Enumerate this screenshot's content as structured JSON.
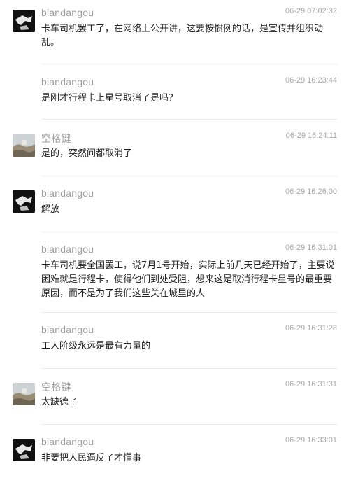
{
  "messages": [
    {
      "username": "biandangou",
      "time": "06-29 07:02:32",
      "avatar": "black-silhouette-avatar",
      "text": "卡车司机罢工了，在网络上公开讲，这要按惯例的话，是宣传并组织动乱。"
    },
    {
      "username": "biandangou",
      "time": "06-29 16:23:44",
      "avatar": "",
      "text": "是刚才行程卡上星号取消了是吗？"
    },
    {
      "username": "空格键",
      "time": "06-29 16:24:11",
      "avatar": "landscape-photo-avatar",
      "text": "是的，突然间都取消了"
    },
    {
      "username": "biandangou",
      "time": "06-29 16:26:00",
      "avatar": "black-silhouette-avatar",
      "text": "解放"
    },
    {
      "username": "biandangou",
      "time": "06-29 16:31:01",
      "avatar": "",
      "text": "卡车司机要全国罢工，说7月1号开始，实际上前几天已经开始了，主要说困难就是行程卡，使得他们到处受阻，想来这是取消行程卡星号的最重要原因，而不是为了我们这些关在城里的人"
    },
    {
      "username": "biandangou",
      "time": "06-29 16:31:28",
      "avatar": "",
      "text": "工人阶级永远是最有力量的"
    },
    {
      "username": "空格键",
      "time": "06-29 16:31:31",
      "avatar": "landscape-photo-avatar",
      "text": "太缺德了"
    },
    {
      "username": "biandangou",
      "time": "06-29 16:33:01",
      "avatar": "black-silhouette-avatar",
      "text": "非要把人民逼反了才懂事"
    }
  ]
}
